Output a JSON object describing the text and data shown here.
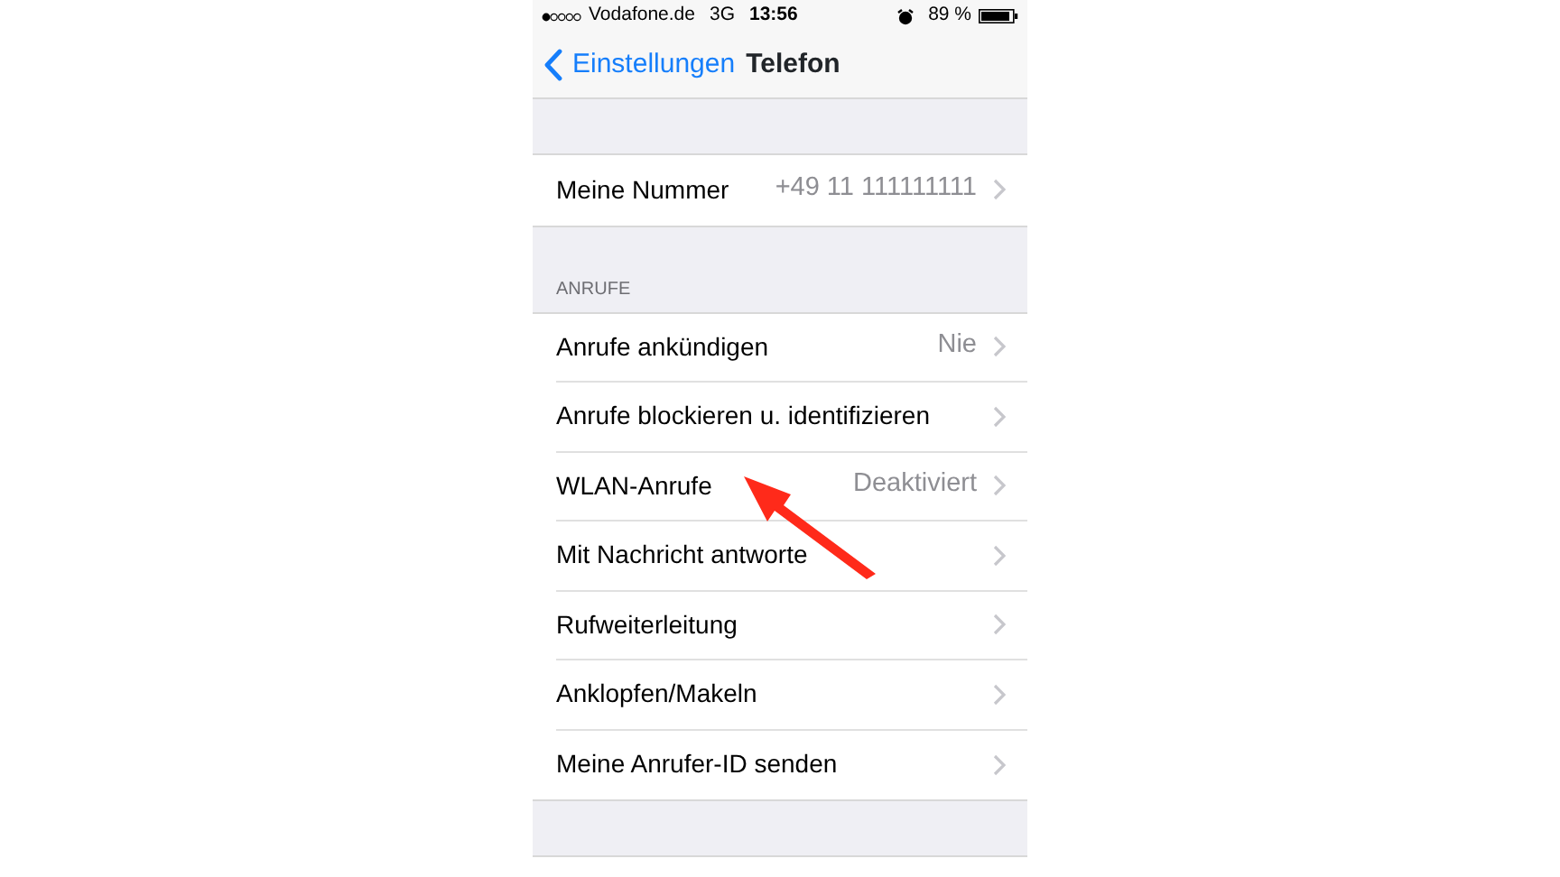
{
  "status_bar": {
    "carrier": "Vodafone.de",
    "network": "3G",
    "time": "13:56",
    "battery": "89 %"
  },
  "nav": {
    "back": "Einstellungen",
    "title": "Telefon"
  },
  "sections": [
    {
      "rows": [
        {
          "label": "Meine Nummer",
          "value": "+49 11 111111111"
        }
      ]
    },
    {
      "header": "ANRUFE",
      "rows": [
        {
          "label": "Anrufe ankündigen",
          "value": "Nie"
        },
        {
          "label": "Anrufe blockieren u. identifizieren"
        },
        {
          "label": "WLAN-Anrufe",
          "value": "Deaktiviert"
        },
        {
          "label": "Mit Nachricht antworte"
        },
        {
          "label": "Rufweiterleitung"
        },
        {
          "label": "Anklopfen/Makeln"
        },
        {
          "label": "Meine Anrufer-ID senden"
        }
      ]
    }
  ]
}
